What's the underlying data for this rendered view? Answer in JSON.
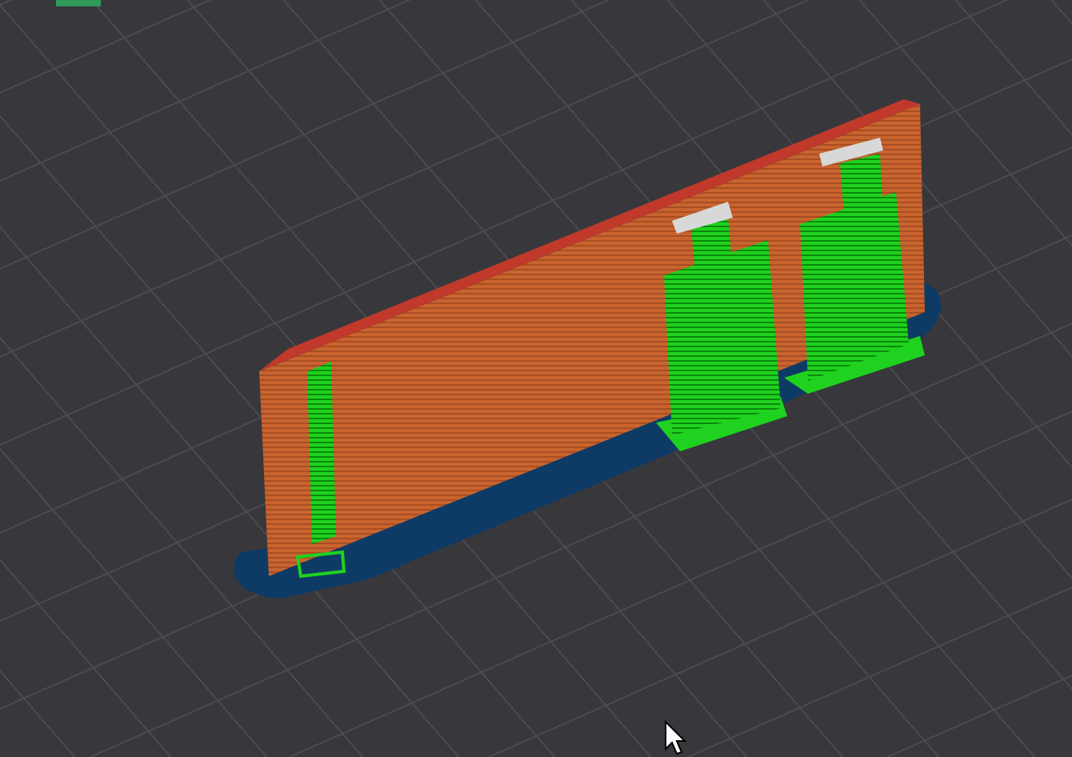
{
  "cursor": {
    "visible": true
  }
}
